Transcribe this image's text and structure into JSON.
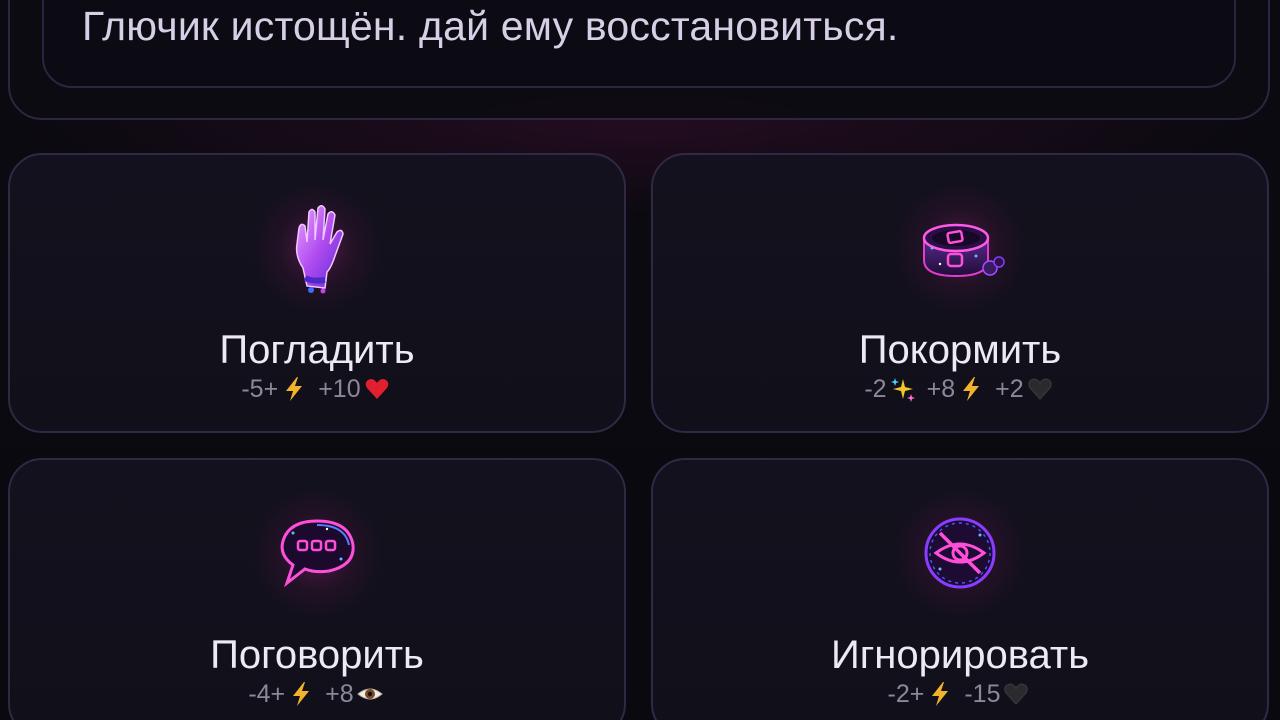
{
  "status": {
    "message": "Глючик истощён. дай ему восстановиться."
  },
  "actions": [
    {
      "title": "Погладить",
      "icon": "hand-icon",
      "stats": [
        {
          "text": "-5+",
          "icon": "lightning-icon"
        },
        {
          "text": "+10",
          "icon": "heart-icon"
        }
      ]
    },
    {
      "title": "Покормить",
      "icon": "food-bowl-icon",
      "stats": [
        {
          "text": "-2",
          "icon": "sparkles-icon"
        },
        {
          "text": "+8",
          "icon": "lightning-icon"
        },
        {
          "text": "+2",
          "icon": "black-heart-icon"
        }
      ]
    },
    {
      "title": "Поговорить",
      "icon": "speech-bubble-icon",
      "stats": [
        {
          "text": "-4+",
          "icon": "lightning-icon"
        },
        {
          "text": "+8",
          "icon": "eye-icon"
        }
      ]
    },
    {
      "title": "Игнорировать",
      "icon": "eye-slash-icon",
      "stats": [
        {
          "text": "-2+",
          "icon": "lightning-icon"
        },
        {
          "text": "-15",
          "icon": "black-heart-icon"
        }
      ]
    }
  ],
  "colors": {
    "background": "#0b0a10",
    "card_border": "#302845",
    "accent_magenta": "#e23ccf",
    "accent_violet": "#7b3cff",
    "title_text": "#eeeaf4",
    "stats_text": "#8d879b",
    "lightning": "#f2b32a",
    "heart": "#e0202e"
  }
}
